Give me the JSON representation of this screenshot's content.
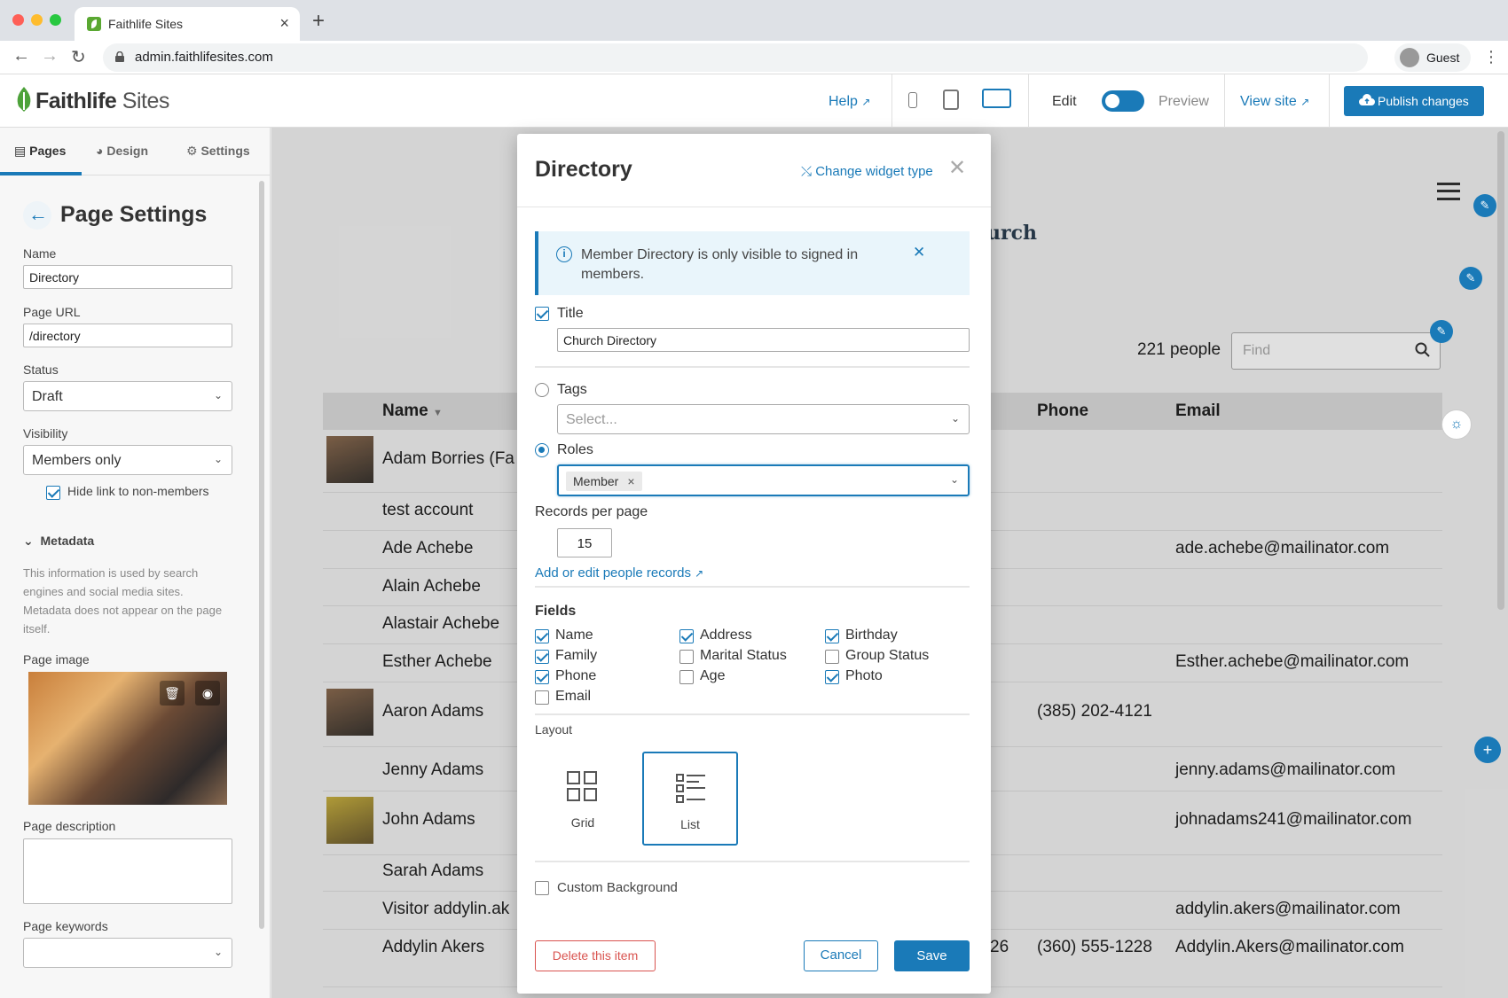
{
  "browser": {
    "tab_title": "Faithlife Sites",
    "url": "admin.faithlifesites.com",
    "profile": "Guest"
  },
  "header": {
    "logo_main": "Faithlife",
    "logo_sub": " Sites",
    "help": "Help",
    "edit": "Edit",
    "preview": "Preview",
    "view_site": "View site",
    "publish": "Publish changes"
  },
  "left_panel": {
    "tabs": [
      {
        "label": "Pages",
        "icon": "page-icon",
        "active": true
      },
      {
        "label": "Design",
        "icon": "palette-icon",
        "active": false
      },
      {
        "label": "Settings",
        "icon": "gear-icon",
        "active": false
      }
    ],
    "title": "Page Settings",
    "name_label": "Name",
    "name_value": "Directory",
    "url_label": "Page URL",
    "url_value": "/directory",
    "status_label": "Status",
    "status_value": "Draft",
    "visibility_label": "Visibility",
    "visibility_value": "Members only",
    "hide_link_label": "Hide link to non-members",
    "metadata_head": "Metadata",
    "metadata_desc": "This information is used by search engines and social media sites. Metadata does not appear on the page itself.",
    "page_image_label": "Page image",
    "page_desc_label": "Page description",
    "page_keywords_label": "Page keywords"
  },
  "site": {
    "church_fragment": "urch",
    "people_count": "221 people",
    "find_placeholder": "Find",
    "columns": {
      "name": "Name",
      "phone": "Phone",
      "email": "Email"
    },
    "rows": [
      {
        "name": "Adam Borries (Fa",
        "phone": "",
        "email": ""
      },
      {
        "name": "test account",
        "phone": "",
        "email": ""
      },
      {
        "name": "Ade Achebe",
        "phone": "",
        "email": "ade.achebe@mailinator.com"
      },
      {
        "name": "Alain Achebe",
        "phone": "",
        "email": ""
      },
      {
        "name": "Alastair Achebe",
        "phone": "",
        "email": ""
      },
      {
        "name": "Esther Achebe",
        "phone": "",
        "email": "Esther.achebe@mailinator.com"
      },
      {
        "name": "Aaron Adams",
        "phone": "(385) 202-4121",
        "email": ""
      },
      {
        "name": "Jenny Adams",
        "phone": "",
        "email": "jenny.adams@mailinator.com"
      },
      {
        "name": "John Adams",
        "phone": "",
        "email": "johnadams241@mailinator.com"
      },
      {
        "name": "Sarah Adams",
        "phone": "",
        "email": ""
      },
      {
        "name": "Visitor addylin.ak",
        "phone": "",
        "email": "addylin.akers@mailinator.com"
      },
      {
        "name": "Addylin Akers",
        "extra": "26",
        "phone": "(360) 555-1228",
        "email": "Addylin.Akers@mailinator.com"
      }
    ]
  },
  "modal": {
    "title": "Directory",
    "change_widget": "Change widget type",
    "info_text": "Member Directory is only visible to signed in members.",
    "title_label": "Title",
    "title_value": "Church Directory",
    "tags_label": "Tags",
    "tags_placeholder": "Select...",
    "roles_label": "Roles",
    "roles_chip": "Member",
    "rpp_label": "Records per page",
    "rpp_value": "15",
    "people_link": "Add or edit people records",
    "fields_head": "Fields",
    "fields": [
      {
        "label": "Name",
        "checked": true
      },
      {
        "label": "Family",
        "checked": true
      },
      {
        "label": "Phone",
        "checked": true
      },
      {
        "label": "Email",
        "checked": false
      },
      {
        "label": "Address",
        "checked": true
      },
      {
        "label": "Marital Status",
        "checked": false
      },
      {
        "label": "Age",
        "checked": false
      },
      {
        "label": "Birthday",
        "checked": true
      },
      {
        "label": "Group Status",
        "checked": false
      },
      {
        "label": "Photo",
        "checked": true
      }
    ],
    "layout_head": "Layout",
    "layout_grid": "Grid",
    "layout_list": "List",
    "layout_selected": "List",
    "custom_bg": "Custom Background",
    "delete": "Delete this item",
    "cancel": "Cancel",
    "save": "Save"
  },
  "colors": {
    "accent": "#1a7ab8",
    "danger": "#d9534f"
  }
}
